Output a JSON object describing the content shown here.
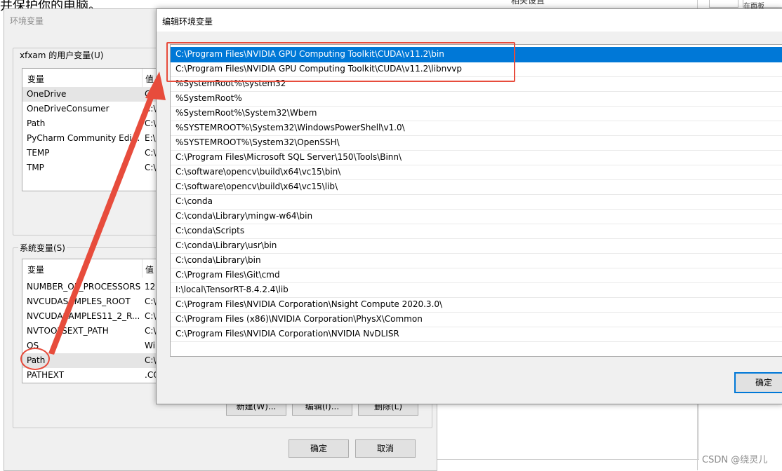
{
  "background": {
    "top_text": "并保护你的电脑。",
    "top_right_text": "相关设置",
    "search_fragment": "在面板"
  },
  "env_dialog": {
    "title": "环境变量",
    "user_group_label": "xfxam 的用户变量(U)",
    "user_headers": {
      "var": "变量",
      "val": "值"
    },
    "user_rows": [
      {
        "name": "OneDrive",
        "value": "C:\\"
      },
      {
        "name": "OneDriveConsumer",
        "value": "C:\\"
      },
      {
        "name": "Path",
        "value": "C:\\"
      },
      {
        "name": "PyCharm Community Edi...",
        "value": "E:\\"
      },
      {
        "name": "TEMP",
        "value": "C:\\"
      },
      {
        "name": "TMP",
        "value": "C:\\"
      }
    ],
    "system_group_label": "系统变量(S)",
    "system_headers": {
      "var": "变量",
      "val": "值"
    },
    "system_rows": [
      {
        "name": "NUMBER_OF_PROCESSORS",
        "value": "12"
      },
      {
        "name": "NVCUDASAMPLES_ROOT",
        "value": "C:\\"
      },
      {
        "name": "NVCUDASAMPLES11_2_R...",
        "value": "C:\\"
      },
      {
        "name": "NVTOOLSEXT_PATH",
        "value": "C:\\"
      },
      {
        "name": "OS",
        "value": "Wi"
      },
      {
        "name": "Path",
        "value": "C:\\"
      },
      {
        "name": "PATHEXT",
        "value": ".CO"
      }
    ],
    "buttons": {
      "new": "新建(W)...",
      "edit": "编辑(I)...",
      "delete": "删除(L)"
    },
    "ok": "确定",
    "cancel": "取消"
  },
  "edit_dialog": {
    "title": "编辑环境变量",
    "entries": [
      "C:\\Program Files\\NVIDIA GPU Computing Toolkit\\CUDA\\v11.2\\bin",
      "C:\\Program Files\\NVIDIA GPU Computing Toolkit\\CUDA\\v11.2\\libnvvp",
      "%SystemRoot%\\system32",
      "%SystemRoot%",
      "%SystemRoot%\\System32\\Wbem",
      "%SYSTEMROOT%\\System32\\WindowsPowerShell\\v1.0\\",
      "%SYSTEMROOT%\\System32\\OpenSSH\\",
      "C:\\Program Files\\Microsoft SQL Server\\150\\Tools\\Binn\\",
      "C:\\software\\opencv\\build\\x64\\vc15\\bin\\",
      "C:\\software\\opencv\\build\\x64\\vc15\\lib\\",
      "C:\\conda",
      "C:\\conda\\Library\\mingw-w64\\bin",
      "C:\\conda\\Scripts",
      "C:\\conda\\Library\\usr\\bin",
      "C:\\conda\\Library\\bin",
      "C:\\Program Files\\Git\\cmd",
      "I:\\local\\TensorRT-8.4.2.4\\lib",
      "C:\\Program Files\\NVIDIA Corporation\\Nsight Compute 2020.3.0\\",
      "C:\\Program Files (x86)\\NVIDIA Corporation\\PhysX\\Common",
      "C:\\Program Files\\NVIDIA Corporation\\NVIDIA NvDLISR"
    ],
    "ok": "确定"
  },
  "watermark": "CSDN @绕灵儿",
  "colors": {
    "selection": "#0078d7",
    "annotation": "#e74c3c"
  }
}
